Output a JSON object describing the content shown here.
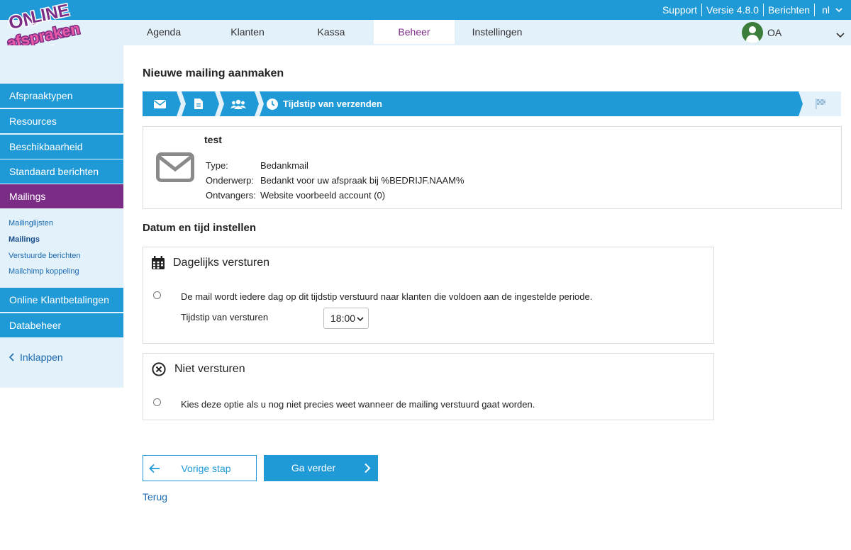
{
  "topbar": {
    "links": [
      "Support",
      "Versie 4.8.0",
      "Berichten"
    ],
    "language": "nl"
  },
  "logo": {
    "alt": "online afspraken .nl"
  },
  "nav": {
    "items": [
      "Agenda",
      "Klanten",
      "Kassa",
      "Beheer",
      "Instellingen"
    ],
    "active": "Beheer",
    "user_initials": "OA"
  },
  "sidebar": {
    "items_top": [
      "Afspraaktypen",
      "Resources",
      "Beschikbaarheid",
      "Standaard berichten",
      "Mailings"
    ],
    "active": "Mailings",
    "sub_items": [
      "Mailinglijsten",
      "Mailings",
      "Verstuurde berichten",
      "Mailchimp koppeling"
    ],
    "active_sub": "Mailings",
    "items_bottom": [
      "Online Klantbetalingen",
      "Databeheer"
    ],
    "collapse_label": "Inklappen"
  },
  "page": {
    "title": "Nieuwe mailing aanmaken"
  },
  "steps": {
    "current_label": "Tijdstip van verzenden",
    "icons": [
      "envelope-icon",
      "document-icon",
      "users-icon",
      "clock-icon",
      "finish-flag-icon"
    ]
  },
  "summary": {
    "name": "test",
    "type_label": "Type:",
    "type_value": "Bedankmail",
    "subject_label": "Onderwerp:",
    "subject_value": "Bedankt voor uw afspraak bij %BEDRIJF.NAAM%",
    "recipients_label": "Ontvangers:",
    "recipients_value": "Website voorbeeld account (0)"
  },
  "schedule": {
    "section_title": "Datum en tijd instellen",
    "daily": {
      "title": "Dagelijks versturen",
      "description": "De mail wordt iedere dag op dit tijdstip verstuurd naar klanten die voldoen aan de ingestelde periode.",
      "time_label": "Tijdstip van versturen",
      "time_value": "18:00",
      "selected": false
    },
    "none": {
      "title": "Niet versturen",
      "description": "Kies deze optie als u nog niet precies weet wanneer de mailing verstuurd gaat worden.",
      "selected": false
    }
  },
  "actions": {
    "prev_label": "Vorige stap",
    "next_label": "Ga verder",
    "back_label": "Terug"
  },
  "colors": {
    "primary": "#1f9ad6",
    "accent": "#7b2d86",
    "nav_bg": "#e3f1fb",
    "step_done": "#e3f1fb"
  }
}
